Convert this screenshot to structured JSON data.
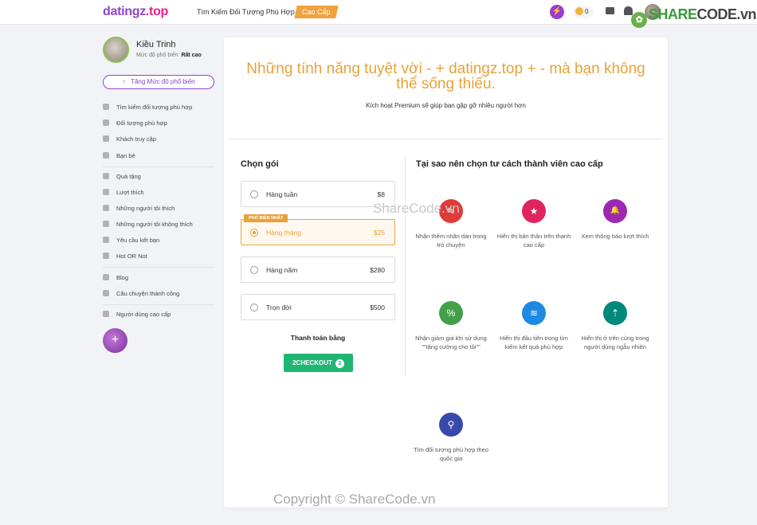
{
  "topbar": {
    "logo_main": "datingz",
    "logo_ext": ".top",
    "nav_find": "Tìm Kiếm Đối Tượng Phù Hợp",
    "nav_premium": "Cao Cấp",
    "credits": "0",
    "watermark": "SHARECODE.vn",
    "watermark_a": "SHARE",
    "watermark_b": "CODE.vn"
  },
  "profile": {
    "name": "Kiều Trinh",
    "popularity_label": "Mức độ phổ biến:",
    "popularity_value": "Rất cao",
    "boost_label": "Tăng Mức độ phổ biến"
  },
  "sidebar": {
    "items": [
      {
        "label": "Tìm kiếm đối tượng phù hợp",
        "icon": "search-user-icon"
      },
      {
        "label": "Đối tượng phù hợp",
        "icon": "match-icon"
      },
      {
        "label": "Khách truy cập",
        "icon": "eye-icon"
      },
      {
        "label": "Bạn bè",
        "icon": "friends-icon"
      },
      {
        "label": "Quà tặng",
        "icon": "gift-icon"
      },
      {
        "label": "Lượt thích",
        "icon": "heart-icon"
      },
      {
        "label": "Những người tôi thích",
        "icon": "user-like-icon"
      },
      {
        "label": "Những người tôi không thích",
        "icon": "thumb-down-icon"
      },
      {
        "label": "Yêu cầu kết bạn",
        "icon": "user-add-icon"
      },
      {
        "label": "Hot OR Not",
        "icon": "fire-icon"
      },
      {
        "label": "Blog",
        "icon": "blog-icon"
      },
      {
        "label": "Câu chuyện thành công",
        "icon": "chart-icon"
      },
      {
        "label": "Người dùng cao cấp",
        "icon": "star-icon"
      }
    ]
  },
  "main": {
    "title": "Những tính năng tuyệt vời - + datingz.top + - mà bạn không thể sống thiếu.",
    "subtitle": "Kích hoạt Premium sẽ giúp bạn gặp gỡ nhiều người hơn",
    "choose_plan": "Chọn gói",
    "plans": [
      {
        "name": "Hàng tuần",
        "price": "$8",
        "selected": false
      },
      {
        "name": "Hàng tháng",
        "price": "$25",
        "selected": true,
        "tag": "PHỔ BIẾN NHẤT"
      },
      {
        "name": "Hàng năm",
        "price": "$280",
        "selected": false
      },
      {
        "name": "Trọn đời",
        "price": "$500",
        "selected": false
      }
    ],
    "pay_with": "Thanh toán bằng",
    "checkout_label": "2CHECKOUT",
    "checkout_badge": "2",
    "why_title": "Tại sao nên chọn tư cách thành viên cao cấp",
    "features": [
      {
        "text": "Nhận thêm nhãn dán trong trò chuyện",
        "color": "#e03a3a",
        "icon": "sticker-icon",
        "glyph": "✎"
      },
      {
        "text": "Hiển thị bản thân trên thanh cao cấp",
        "color": "#e0245e",
        "icon": "star-icon",
        "glyph": "★"
      },
      {
        "text": "Xem thông báo lượt thích",
        "color": "#9c27b0",
        "icon": "bell-icon",
        "glyph": "🔔"
      },
      {
        "text": "Nhận giảm giá khi sử dụng \"\"tăng cường cho tôi\"\"",
        "color": "#43a047",
        "icon": "discount-icon",
        "glyph": "%"
      },
      {
        "text": "Hiển thị đầu tiên trong tìm kiếm kết quả phù hợp",
        "color": "#1e88e5",
        "icon": "layers-icon",
        "glyph": "≋"
      },
      {
        "text": "Hiển thị ở trên cùng trong người dùng ngẫu nhiên",
        "color": "#00897b",
        "icon": "top-arrow-icon",
        "glyph": "⇡"
      },
      {
        "text": "Tìm đối tượng phù hợp theo quốc gia",
        "color": "#3949ab",
        "icon": "location-pin-icon",
        "glyph": "⚲"
      }
    ]
  },
  "watermarks": {
    "middle": "ShareCode.vn",
    "bottom": "Copyright © ShareCode.vn"
  }
}
